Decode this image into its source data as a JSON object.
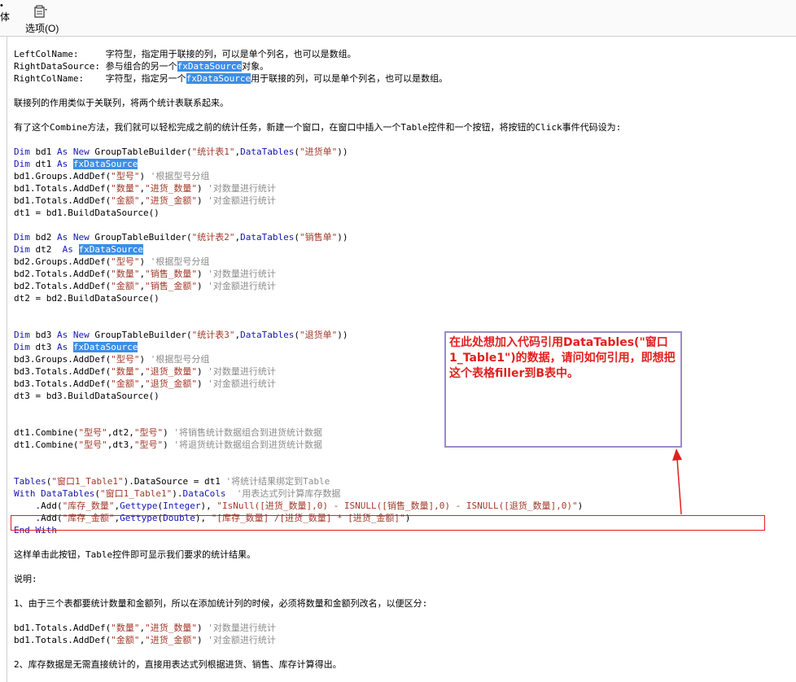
{
  "toolbar": {
    "left_fragment": "体",
    "options_label": "选项(O)"
  },
  "colors": {
    "keyword": "#1515b0",
    "string": "#a23a2a",
    "comment": "#8c8c8c",
    "highlight": "#3c8ee6",
    "annotation": "#e02020"
  },
  "doc": {
    "lines": [
      [
        {
          "t": "LeftColName:     字符型，指定用于联接的列，可以是单个列名，也可以是数组。"
        }
      ],
      [
        {
          "t": "RightDataSource: 参与组合的另一个"
        },
        {
          "t": "fxDataSource",
          "c": "hl"
        },
        {
          "t": "对象。"
        }
      ],
      [
        {
          "t": "RightColName:    字符型，指定另一个"
        },
        {
          "t": "fxDataSource",
          "c": "hl"
        },
        {
          "t": "用于联接的列，可以是单个列名，也可以是数组。"
        }
      ],
      [],
      [
        {
          "t": "联接列的作用类似于关联列，将两个统计表联系起来。"
        }
      ],
      [],
      [
        {
          "t": "有了这个Combine方法，我们就可以轻松完成之前的统计任务，新建一个窗口，在窗口中插入一个Table控件和一个按钮，将按钮的Click事件代码设为:"
        }
      ],
      [],
      [
        {
          "t": "Dim",
          "c": "kw"
        },
        {
          "t": " bd1 "
        },
        {
          "t": "As",
          "c": "kw"
        },
        {
          "t": " "
        },
        {
          "t": "New",
          "c": "kw"
        },
        {
          "t": " GroupTableBuilder("
        },
        {
          "t": "\"统计表1\"",
          "c": "str"
        },
        {
          "t": ","
        },
        {
          "t": "DataTables",
          "c": "kw"
        },
        {
          "t": "("
        },
        {
          "t": "\"进货单\"",
          "c": "str"
        },
        {
          "t": "))"
        }
      ],
      [
        {
          "t": "Dim",
          "c": "kw"
        },
        {
          "t": " dt1 "
        },
        {
          "t": "As",
          "c": "kw"
        },
        {
          "t": " "
        },
        {
          "t": "fxDataSource",
          "c": "hl"
        }
      ],
      [
        {
          "t": "bd1.Groups.AddDef("
        },
        {
          "t": "\"型号\"",
          "c": "str"
        },
        {
          "t": ") "
        },
        {
          "t": "'根据型号分组",
          "c": "cm"
        }
      ],
      [
        {
          "t": "bd1.Totals.AddDef("
        },
        {
          "t": "\"数量\"",
          "c": "str"
        },
        {
          "t": ","
        },
        {
          "t": "\"进货_数量\"",
          "c": "str"
        },
        {
          "t": ") "
        },
        {
          "t": "'对数量进行统计",
          "c": "cm"
        }
      ],
      [
        {
          "t": "bd1.Totals.AddDef("
        },
        {
          "t": "\"金额\"",
          "c": "str"
        },
        {
          "t": ","
        },
        {
          "t": "\"进货_金额\"",
          "c": "str"
        },
        {
          "t": ") "
        },
        {
          "t": "'对金额进行统计",
          "c": "cm"
        }
      ],
      [
        {
          "t": "dt1 = bd1.BuildDataSource()"
        }
      ],
      [],
      [
        {
          "t": "Dim",
          "c": "kw"
        },
        {
          "t": " bd2 "
        },
        {
          "t": "As",
          "c": "kw"
        },
        {
          "t": " "
        },
        {
          "t": "New",
          "c": "kw"
        },
        {
          "t": " GroupTableBuilder("
        },
        {
          "t": "\"统计表2\"",
          "c": "str"
        },
        {
          "t": ","
        },
        {
          "t": "DataTables",
          "c": "kw"
        },
        {
          "t": "("
        },
        {
          "t": "\"销售单\"",
          "c": "str"
        },
        {
          "t": "))"
        }
      ],
      [
        {
          "t": "Dim",
          "c": "kw"
        },
        {
          "t": " dt2  "
        },
        {
          "t": "As",
          "c": "kw"
        },
        {
          "t": " "
        },
        {
          "t": "fxDataSource",
          "c": "hl"
        }
      ],
      [
        {
          "t": "bd2.Groups.AddDef("
        },
        {
          "t": "\"型号\"",
          "c": "str"
        },
        {
          "t": ") "
        },
        {
          "t": "'根据型号分组",
          "c": "cm"
        }
      ],
      [
        {
          "t": "bd2.Totals.AddDef("
        },
        {
          "t": "\"数量\"",
          "c": "str"
        },
        {
          "t": ","
        },
        {
          "t": "\"销售_数量\"",
          "c": "str"
        },
        {
          "t": ") "
        },
        {
          "t": "'对数量进行统计",
          "c": "cm"
        }
      ],
      [
        {
          "t": "bd2.Totals.AddDef("
        },
        {
          "t": "\"金额\"",
          "c": "str"
        },
        {
          "t": ","
        },
        {
          "t": "\"销售_金额\"",
          "c": "str"
        },
        {
          "t": ") "
        },
        {
          "t": "'对金额进行统计",
          "c": "cm"
        }
      ],
      [
        {
          "t": "dt2 = bd2.BuildDataSource()"
        }
      ],
      [],
      [],
      [
        {
          "t": "Dim",
          "c": "kw"
        },
        {
          "t": " bd3 "
        },
        {
          "t": "As",
          "c": "kw"
        },
        {
          "t": " "
        },
        {
          "t": "New",
          "c": "kw"
        },
        {
          "t": " GroupTableBuilder("
        },
        {
          "t": "\"统计表3\"",
          "c": "str"
        },
        {
          "t": ","
        },
        {
          "t": "DataTables",
          "c": "kw"
        },
        {
          "t": "("
        },
        {
          "t": "\"退货单\"",
          "c": "str"
        },
        {
          "t": "))"
        }
      ],
      [
        {
          "t": "Dim",
          "c": "kw"
        },
        {
          "t": " dt3 "
        },
        {
          "t": "As",
          "c": "kw"
        },
        {
          "t": " "
        },
        {
          "t": "fxDataSource",
          "c": "hl"
        }
      ],
      [
        {
          "t": "bd3.Groups.AddDef("
        },
        {
          "t": "\"型号\"",
          "c": "str"
        },
        {
          "t": ") "
        },
        {
          "t": "'根据型号分组",
          "c": "cm"
        }
      ],
      [
        {
          "t": "bd3.Totals.AddDef("
        },
        {
          "t": "\"数量\"",
          "c": "str"
        },
        {
          "t": ","
        },
        {
          "t": "\"退货_数量\"",
          "c": "str"
        },
        {
          "t": ") "
        },
        {
          "t": "'对数量进行统计",
          "c": "cm"
        }
      ],
      [
        {
          "t": "bd3.Totals.AddDef("
        },
        {
          "t": "\"金额\"",
          "c": "str"
        },
        {
          "t": ","
        },
        {
          "t": "\"退货_金额\"",
          "c": "str"
        },
        {
          "t": ") "
        },
        {
          "t": "'对金额进行统计",
          "c": "cm"
        }
      ],
      [
        {
          "t": "dt3 = bd3.BuildDataSource()"
        }
      ],
      [],
      [],
      [
        {
          "t": "dt1.Combine("
        },
        {
          "t": "\"型号\"",
          "c": "str"
        },
        {
          "t": ",dt2,"
        },
        {
          "t": "\"型号\"",
          "c": "str"
        },
        {
          "t": ") "
        },
        {
          "t": "'将销售统计数据组合到进货统计数据",
          "c": "cm"
        }
      ],
      [
        {
          "t": "dt1.Combine("
        },
        {
          "t": "\"型号\"",
          "c": "str"
        },
        {
          "t": ",dt3,"
        },
        {
          "t": "\"型号\"",
          "c": "str"
        },
        {
          "t": ") "
        },
        {
          "t": "'将退货统计数据组合到进货统计数据",
          "c": "cm"
        }
      ],
      [],
      [],
      [
        {
          "t": "Tables",
          "c": "kw"
        },
        {
          "t": "("
        },
        {
          "t": "\"窗口1_Table1\"",
          "c": "str"
        },
        {
          "t": ").DataSource = dt1 "
        },
        {
          "t": "'将统计结果绑定到Table",
          "c": "cm"
        }
      ],
      [
        {
          "t": "With",
          "c": "kw"
        },
        {
          "t": " "
        },
        {
          "t": "DataTables",
          "c": "kw"
        },
        {
          "t": "("
        },
        {
          "t": "\"窗口1_Table1\"",
          "c": "str"
        },
        {
          "t": ")."
        },
        {
          "t": "DataCols",
          "c": "kw"
        },
        {
          "t": "  "
        },
        {
          "t": "'用表达式列计算库存数据",
          "c": "cm"
        }
      ],
      [
        {
          "t": "    .Add("
        },
        {
          "t": "\"库存_数量\"",
          "c": "str"
        },
        {
          "t": ","
        },
        {
          "t": "Gettype",
          "c": "kw"
        },
        {
          "t": "("
        },
        {
          "t": "Integer",
          "c": "kw"
        },
        {
          "t": "), "
        },
        {
          "t": "\"IsNull([进货_数量],0) - ISNULL([销售_数量],0) - ISNULL([退货_数量],0)\"",
          "c": "str"
        },
        {
          "t": ")"
        }
      ],
      [
        {
          "t": "    .Add("
        },
        {
          "t": "\"库存_金额\"",
          "c": "str"
        },
        {
          "t": ","
        },
        {
          "t": "Gettype",
          "c": "kw"
        },
        {
          "t": "("
        },
        {
          "t": "Double",
          "c": "kw"
        },
        {
          "t": "), "
        },
        {
          "t": "\"[库存_数量] /[进货_数量] * [进货_金额]\"",
          "c": "str"
        },
        {
          "t": ")"
        }
      ],
      [
        {
          "t": "End With",
          "c": "kw"
        }
      ],
      [],
      [
        {
          "t": "这样单击此按钮，Table控件即可显示我们要求的统计结果。"
        }
      ],
      [],
      [
        {
          "t": "说明:"
        }
      ],
      [],
      [
        {
          "t": "1、由于三个表都要统计数量和金额列，所以在添加统计列的时候，必须将数量和金额列改名，以便区分:"
        }
      ],
      [],
      [
        {
          "t": "bd1.Totals.AddDef("
        },
        {
          "t": "\"数量\"",
          "c": "str"
        },
        {
          "t": ","
        },
        {
          "t": "\"进货_数量\"",
          "c": "str"
        },
        {
          "t": ") "
        },
        {
          "t": "'对数量进行统计",
          "c": "cm"
        }
      ],
      [
        {
          "t": "bd1.Totals.AddDef("
        },
        {
          "t": "\"金额\"",
          "c": "str"
        },
        {
          "t": ","
        },
        {
          "t": "\"进货_金额\"",
          "c": "str"
        },
        {
          "t": ") "
        },
        {
          "t": "'对金额进行统计",
          "c": "cm"
        }
      ],
      [],
      [
        {
          "t": "2、库存数据是无需直接统计的，直接用表达式列根据进货、销售、库存计算得出。"
        }
      ]
    ]
  },
  "annotation": {
    "text": "在此处想加入代码引用DataTables(\"窗口1_Table1\")的数据，请问如何引用，即想把这个表格filler到B表中。"
  }
}
